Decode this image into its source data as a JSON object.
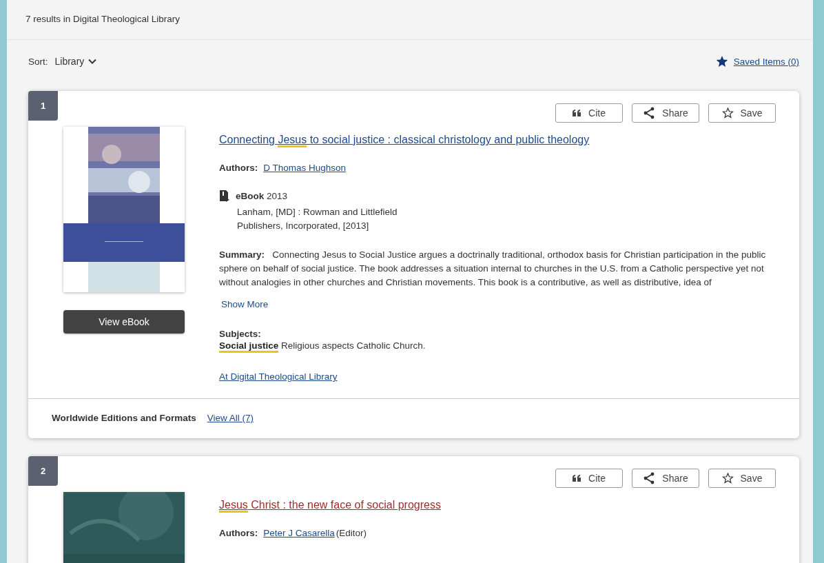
{
  "results_header": "7 results in Digital Theological Library",
  "sort": {
    "label": "Sort:",
    "value": "Library"
  },
  "saved_items": {
    "label": "Saved Items (0)"
  },
  "results": [
    {
      "number": "1",
      "actions": [
        "Cite",
        "Share",
        "Save"
      ],
      "cover": {
        "kind": "picture"
      },
      "title_parts": [
        {
          "text": "Connecting ",
          "highlight": false
        },
        {
          "text": "Jesus",
          "highlight": true
        },
        {
          "text": " to social justice : classical christology and public theology",
          "highlight": false
        }
      ],
      "visited": false,
      "authors_label": "Authors:",
      "authors": [
        {
          "name": "D Thomas Hughson"
        }
      ],
      "format": "eBook",
      "year": "2013",
      "publisher_lines": [
        "Lanham, [MD] : Rowman and Littlefield",
        "Publishers, Incorporated, [2013]"
      ],
      "summary_label": "Summary:",
      "summary": "Connecting Jesus to Social Justice argues a doctrinally traditional, orthodox basis for Christian participation in the public sphere on behalf of social justice. The book addresses a situation internal to churches in the U.S. from a Catholic perspective yet not without analogies in other churches and Christian movements. This book is a contributive, as well as distributive, idea of",
      "show_more": "Show More",
      "view_button": "View eBook",
      "subjects_label": "Subjects:",
      "subject_parts": [
        {
          "text": "Social justice",
          "highlight": true
        },
        {
          "text": " Religious aspects Catholic Church.",
          "highlight": false
        }
      ],
      "holding_link": "At Digital Theological Library",
      "editions_label": "Worldwide Editions and Formats",
      "editions_link": "View All (7)"
    },
    {
      "number": "2",
      "actions": [
        "Cite",
        "Share",
        "Save"
      ],
      "cover": {
        "kind": "picture"
      },
      "title_parts": [
        {
          "text": "Jesus",
          "highlight": true
        },
        {
          "text": " Christ : the new face of social progress",
          "highlight": false
        }
      ],
      "visited": true,
      "authors_label": "Authors:",
      "authors": [
        {
          "name": "Peter J Casarella",
          "role": "(Editor)"
        }
      ]
    }
  ]
}
